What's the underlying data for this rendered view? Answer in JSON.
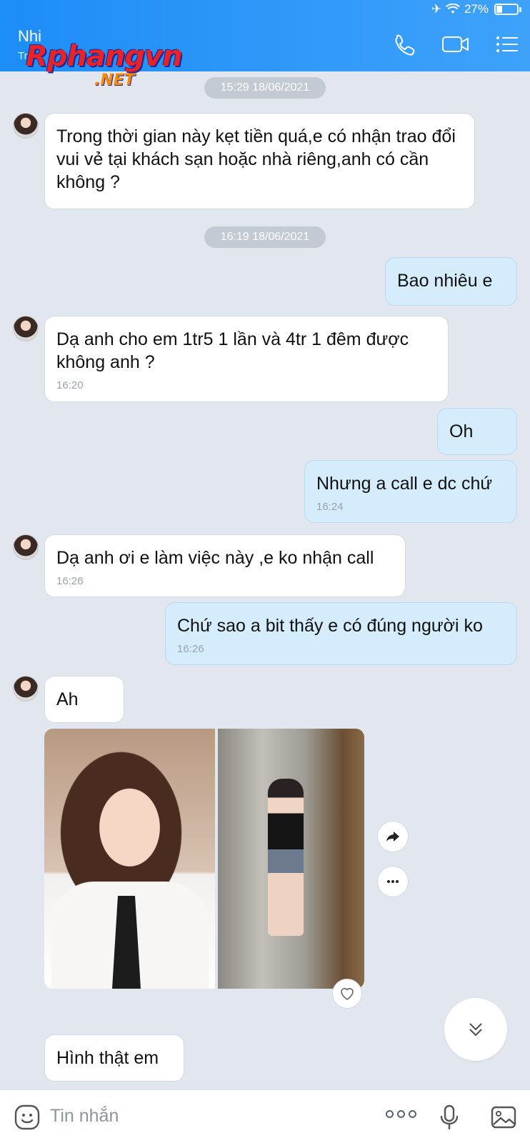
{
  "status_bar": {
    "battery": "27%"
  },
  "header": {
    "contact_name": "Nhi",
    "contact_sub": "Tr",
    "watermark_main": "Rphangvn",
    "watermark_net": ".NET"
  },
  "chat": {
    "date_chips": [
      "15:29 18/06/2021",
      "16:19 18/06/2021"
    ],
    "messages": [
      {
        "dir": "in",
        "text": "Trong thời gian này kẹt tiền quá,e có nhận trao đổi vui vẻ tại khách sạn hoặc nhà riêng,anh có cần không ?",
        "time": ""
      },
      {
        "dir": "out",
        "text": "Bao nhiêu e",
        "time": ""
      },
      {
        "dir": "in",
        "text": "Dạ anh cho em 1tr5 1 lần và 4tr 1 đêm được không anh ?",
        "time": "16:20"
      },
      {
        "dir": "out",
        "text": "Oh",
        "time": ""
      },
      {
        "dir": "out",
        "text": "Nhưng a call e dc chứ",
        "time": "16:24"
      },
      {
        "dir": "in",
        "text": "Dạ anh ơi e làm việc này ,e ko nhận call",
        "time": "16:26"
      },
      {
        "dir": "out",
        "text": "Chứ sao a bit thấy e có đúng người ko",
        "time": "16:26"
      },
      {
        "dir": "in",
        "text": "Ah",
        "time": ""
      },
      {
        "dir": "in",
        "text": "Hình thật em",
        "time": ""
      }
    ]
  },
  "input": {
    "placeholder": "Tin nhắn"
  },
  "colors": {
    "header": "#1d8df7",
    "bubble_out": "#d5ecfc",
    "background": "#e2e7ef"
  }
}
